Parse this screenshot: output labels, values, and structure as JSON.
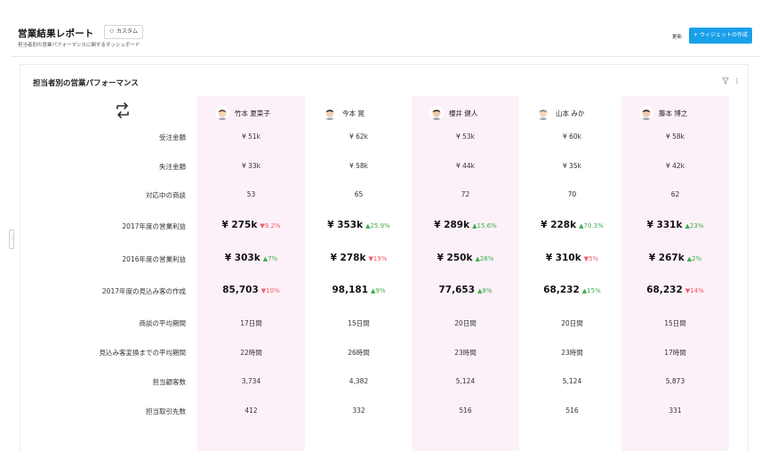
{
  "header": {
    "title": "営業結果レポート",
    "tag": "カスタム",
    "subtitle": "担当者別の営業パフォーマンスに関するダッシュボード",
    "refresh": "更新",
    "create_button": "+ ウィジェットの作成"
  },
  "card": {
    "title": "担当者別の営業パフォーマンス"
  },
  "people": [
    {
      "name": "竹本 夏菜子",
      "highlight": true
    },
    {
      "name": "今本 晃",
      "highlight": false
    },
    {
      "name": "櫻井 健人",
      "highlight": true
    },
    {
      "name": "山本 みか",
      "highlight": false
    },
    {
      "name": "藤本 博之",
      "highlight": true
    }
  ],
  "rows": [
    {
      "label": "受注金額",
      "big": false,
      "values": [
        "¥ 51k",
        "¥ 62k",
        "¥ 53k",
        "¥ 60k",
        "¥ 58k"
      ]
    },
    {
      "label": "失注金額",
      "big": false,
      "values": [
        "¥ 33k",
        "¥ 58k",
        "¥ 44k",
        "¥ 35k",
        "¥ 42k"
      ]
    },
    {
      "label": "対応中の商談",
      "big": false,
      "values": [
        "53",
        "65",
        "72",
        "70",
        "62"
      ]
    },
    {
      "label": "2017年度の営業利益",
      "big": true,
      "values": [
        "¥ 275k",
        "¥ 353k",
        "¥ 289k",
        "¥ 228k",
        "¥ 331k"
      ],
      "changes": [
        {
          "dir": "down",
          "text": "9.2%"
        },
        {
          "dir": "up",
          "text": "25.9%"
        },
        {
          "dir": "up",
          "text": "15.6%"
        },
        {
          "dir": "up",
          "text": "70.3%"
        },
        {
          "dir": "up",
          "text": "23%"
        }
      ]
    },
    {
      "label": "2016年度の営業利益",
      "big": true,
      "values": [
        "¥ 303k",
        "¥ 278k",
        "¥ 250k",
        "¥ 310k",
        "¥ 267k"
      ],
      "changes": [
        {
          "dir": "up",
          "text": "7%"
        },
        {
          "dir": "down",
          "text": "19%"
        },
        {
          "dir": "up",
          "text": "28%"
        },
        {
          "dir": "down",
          "text": "5%"
        },
        {
          "dir": "up",
          "text": "2%"
        }
      ]
    },
    {
      "label": "2017年度の見込み客の作成",
      "big": true,
      "values": [
        "85,703",
        "98,181",
        "77,653",
        "68,232",
        "68,232"
      ],
      "changes": [
        {
          "dir": "down",
          "text": "10%"
        },
        {
          "dir": "up",
          "text": "9%"
        },
        {
          "dir": "up",
          "text": "8%"
        },
        {
          "dir": "up",
          "text": "15%"
        },
        {
          "dir": "down",
          "text": "14%"
        }
      ]
    },
    {
      "label": "商談の平均期間",
      "big": false,
      "values": [
        "17日間",
        "15日間",
        "20日間",
        "20日間",
        "15日間"
      ]
    },
    {
      "label": "見込み客変換までの平均期間",
      "big": false,
      "values": [
        "22時間",
        "26時間",
        "23時間",
        "23時間",
        "17時間"
      ]
    },
    {
      "label": "担当顧客数",
      "big": false,
      "values": [
        "3,734",
        "4,382",
        "5,124",
        "5,124",
        "5,873"
      ]
    },
    {
      "label": "担当取引先数",
      "big": false,
      "values": [
        "412",
        "332",
        "516",
        "516",
        "331"
      ]
    }
  ],
  "colors": {
    "accent": "#1aa0e8",
    "highlight_column": "#fdf1f9",
    "up": "#3dad4a",
    "down": "#ef5a6a"
  },
  "icons": {
    "swap": "swap-arrows-icon",
    "filter": "filter-icon",
    "more": "more-vertical-icon"
  }
}
